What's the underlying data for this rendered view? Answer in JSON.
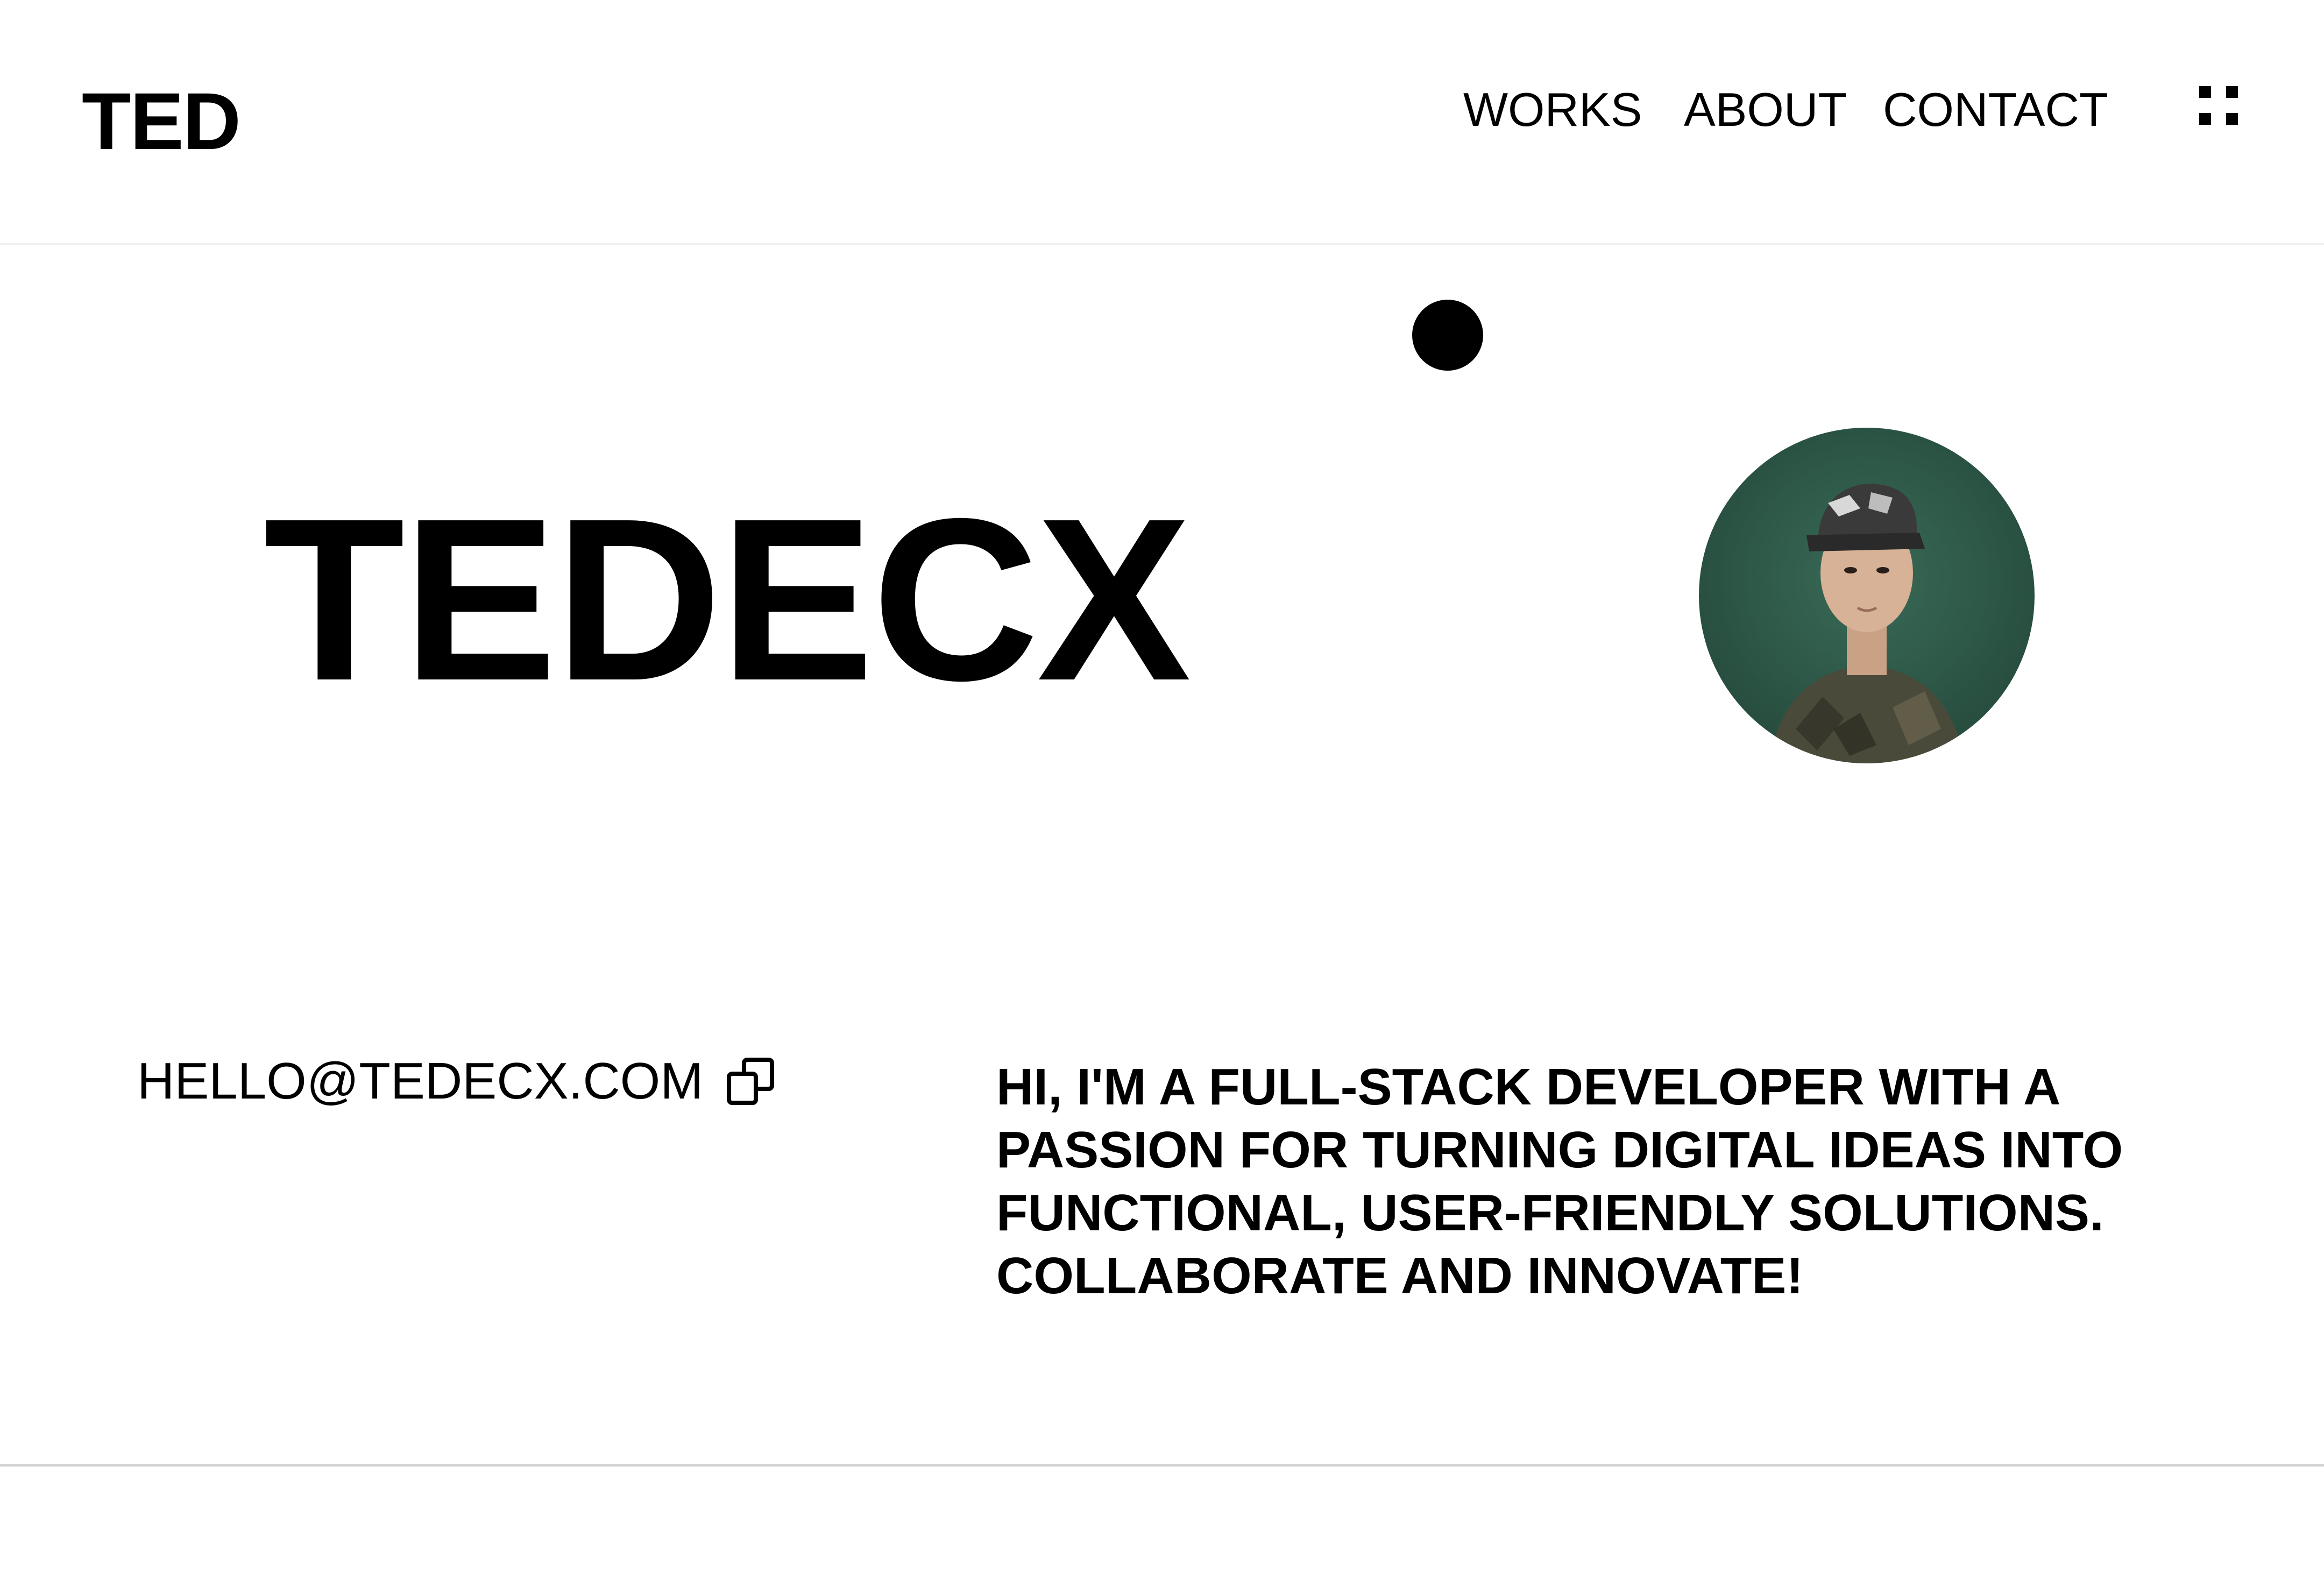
{
  "header": {
    "logo": "TED",
    "nav": [
      "WORKS",
      "ABOUT",
      "CONTACT"
    ]
  },
  "hero": {
    "title": "TEDECX"
  },
  "contact": {
    "email": "HELLO@TEDECX.COM"
  },
  "bio": {
    "text": "HI, I'M A FULL-STACK DEVELOPER WITH A PASSION FOR TURNING DIGITAL IDEAS INTO FUNCTIONAL, USER-FRIENDLY SOLUTIONS. COLLABORATE AND INNOVATE!"
  },
  "icons": {
    "menu": "grid-menu-icon",
    "copy": "copy-icon"
  },
  "colors": {
    "text": "#000000",
    "background": "#ffffff",
    "avatar_bg": "#2e5a48"
  }
}
